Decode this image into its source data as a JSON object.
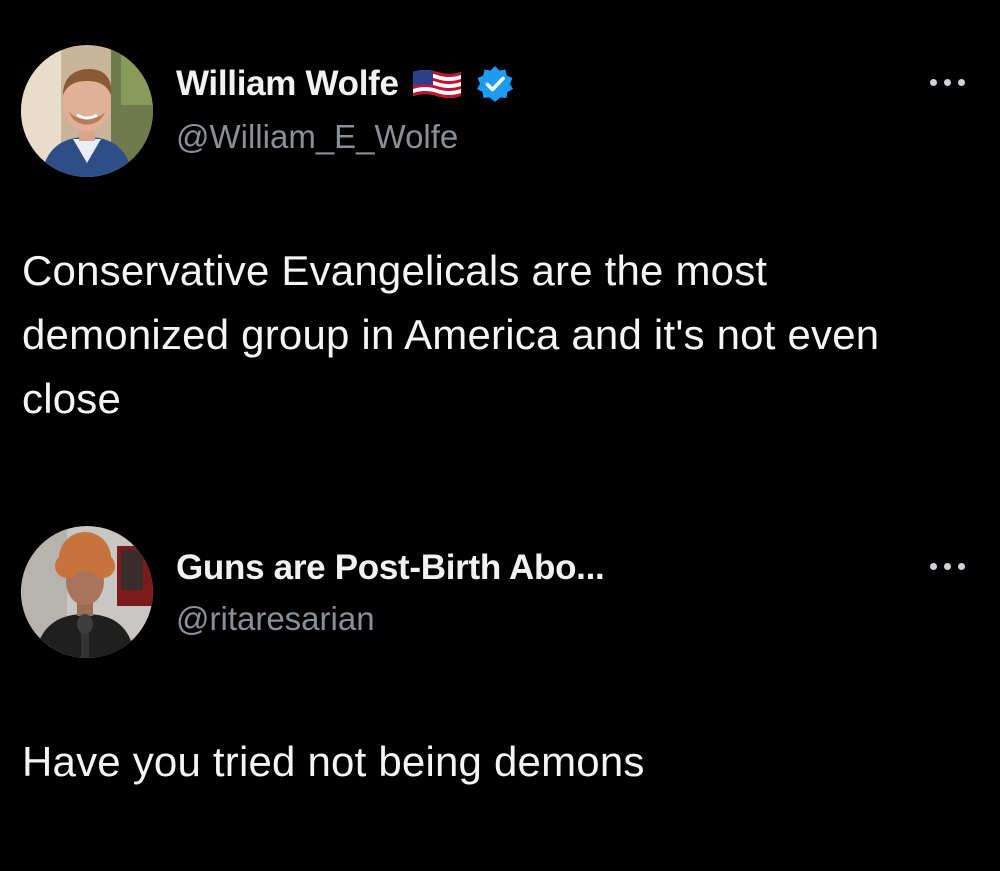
{
  "post1": {
    "display_name": "William Wolfe",
    "handle": "@William_E_Wolfe",
    "text": "Conservative Evangelicals are the most demonized group in America and it's not even close",
    "flag_icon": "us-flag-icon",
    "verified_icon": "verified-badge-icon",
    "verified_color": "#1d9bf0"
  },
  "post2": {
    "display_name": "Guns are Post-Birth Abo...",
    "handle": "@ritaresarian",
    "text": "Have you tried not being demons"
  },
  "colors": {
    "background": "#000000",
    "text": "#f5f5f5",
    "handle": "#8b9096"
  }
}
